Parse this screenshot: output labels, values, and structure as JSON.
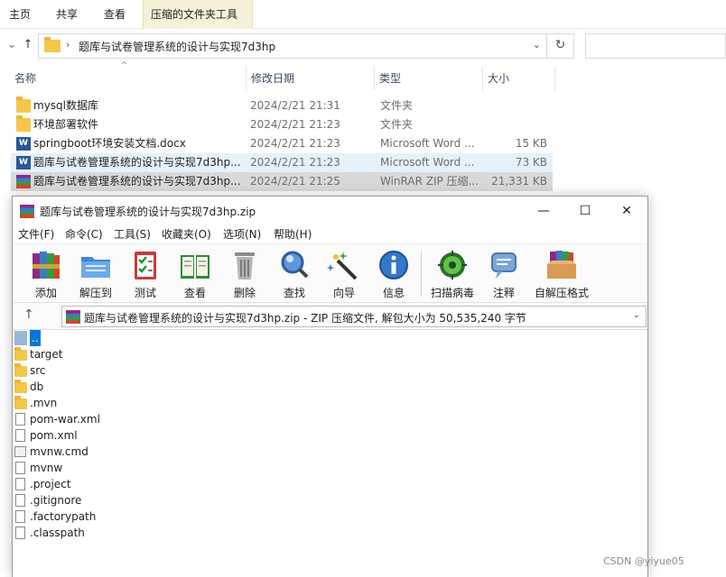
{
  "explorer": {
    "ribbon_tabs": [
      "主页",
      "共享",
      "查看",
      "压缩的文件夹工具"
    ],
    "address_path": "题库与试卷管理系统的设计与实现7d3hp",
    "columns": [
      "名称",
      "修改日期",
      "类型",
      "大小"
    ],
    "files": [
      {
        "name": "mysql数据库",
        "date": "2024/2/21 21:31",
        "type": "文件夹",
        "size": "",
        "icon": "folder-icon"
      },
      {
        "name": "环境部署软件",
        "date": "2024/2/21 21:23",
        "type": "文件夹",
        "size": "",
        "icon": "folder-icon"
      },
      {
        "name": "springboot环境安装文档.docx",
        "date": "2024/2/21 21:23",
        "type": "Microsoft Word ...",
        "size": "15 KB",
        "icon": "word-icon"
      },
      {
        "name": "题库与试卷管理系统的设计与实现7d3hp...",
        "date": "2024/2/21 21:23",
        "type": "Microsoft Word ...",
        "size": "73 KB",
        "icon": "word-icon"
      },
      {
        "name": "题库与试卷管理系统的设计与实现7d3hp...",
        "date": "2024/2/21 21:25",
        "type": "WinRAR ZIP 压缩...",
        "size": "21,331 KB",
        "icon": "winrar-icon"
      }
    ]
  },
  "rar": {
    "title": "题库与试卷管理系统的设计与实现7d3hp.zip",
    "window_buttons": {
      "minimize": "—",
      "maximize": "☐",
      "close": "✕"
    },
    "menu": [
      "文件(F)",
      "命令(C)",
      "工具(S)",
      "收藏夹(O)",
      "选项(N)",
      "帮助(H)"
    ],
    "toolbar": [
      "添加",
      "解压到",
      "测试",
      "查看",
      "删除",
      "查找",
      "向导",
      "信息",
      "扫描病毒",
      "注释",
      "自解压格式"
    ],
    "path_text": "题库与试卷管理系统的设计与实现7d3hp.zip - ZIP 压缩文件, 解包大小为 50,535,240 字节",
    "entries": [
      "..",
      "target",
      "src",
      "db",
      ".mvn",
      "pom-war.xml",
      "pom.xml",
      "mvnw.cmd",
      "mvnw",
      ".project",
      ".gitignore",
      ".factorypath",
      ".classpath"
    ]
  },
  "watermark": "CSDN @yiyue05"
}
